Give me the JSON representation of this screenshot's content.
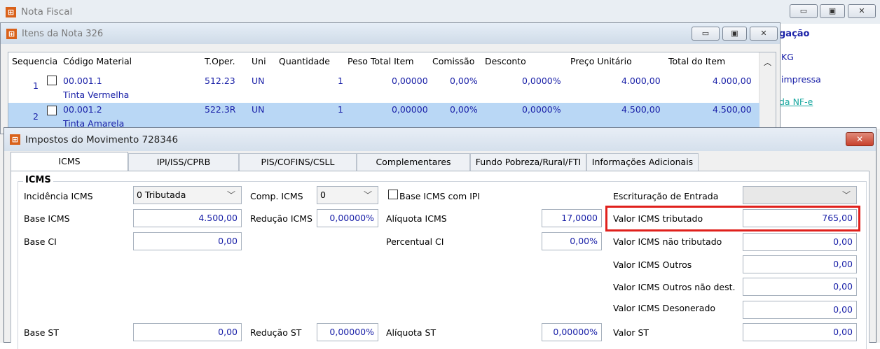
{
  "nota_window": {
    "title": "Nota Fiscal",
    "right_links": [
      "gação",
      "KG",
      "impressa",
      "da NF-e"
    ]
  },
  "itens_window": {
    "title": "Itens da Nota 326",
    "columns": [
      "Sequencia",
      "Código Material",
      "T.Oper.",
      "Uni",
      "Quantidade",
      "Peso Total Item",
      "Comissão",
      "Desconto",
      "Preço Unitário",
      "Total do Item"
    ],
    "rows": [
      {
        "seq": "1",
        "code": "00.001.1",
        "desc": "Tinta Vermelha",
        "toper": "512.23",
        "uni": "UN",
        "qtd": "1",
        "peso": "0,00000",
        "comissao": "0,00%",
        "desconto": "0,0000%",
        "preco": "4.000,00",
        "total": "4.000,00"
      },
      {
        "seq": "2",
        "code": "00.001.2",
        "desc": "Tinta Amarela",
        "toper": "522.3R",
        "uni": "UN",
        "qtd": "1",
        "peso": "0,00000",
        "comissao": "0,00%",
        "desconto": "0,0000%",
        "preco": "4.500,00",
        "total": "4.500,00"
      }
    ]
  },
  "impostos_window": {
    "title": "Impostos do Movimento 728346",
    "close_label": "✕",
    "tabs": [
      "ICMS",
      "IPI/ISS/CPRB",
      "PIS/COFINS/CSLL",
      "Complementares",
      "Fundo Pobreza/Rural/FTI",
      "Informações Adicionais"
    ],
    "active_tab": "ICMS",
    "group_title": "ICMS",
    "incidencia_label": "Incidência ICMS",
    "incidencia_value": "0 Tributada",
    "comp_label": "Comp. ICMS",
    "comp_value": "0",
    "base_ipi_label": "Base ICMS com IPI",
    "escrituracao_label": "Escrituração de Entrada",
    "escrituracao_value": "",
    "base_icms_label": "Base ICMS",
    "base_icms_value": "4.500,00",
    "reducao_icms_label": "Redução ICMS",
    "reducao_icms_value": "0,00000%",
    "aliquota_icms_label": "Alíquota ICMS",
    "aliquota_icms_value": "17,0000",
    "valor_tributado_label": "Valor ICMS tributado",
    "valor_tributado_value": "765,00",
    "base_ci_label": "Base CI",
    "base_ci_value": "0,00",
    "percentual_ci_label": "Percentual CI",
    "percentual_ci_value": "0,00%",
    "nao_tributado_label": "Valor ICMS não tributado",
    "nao_tributado_value": "0,00",
    "outros_label": "Valor ICMS Outros",
    "outros_value": "0,00",
    "outros_nao_dest_label": "Valor ICMS Outros não dest.",
    "outros_nao_dest_value": "0,00",
    "desonerado_label": "Valor ICMS Desonerado",
    "desonerado_value": "0,00",
    "base_st_label": "Base ST",
    "base_st_value": "0,00",
    "reducao_st_label": "Redução ST",
    "reducao_st_value": "0,00000%",
    "aliquota_st_label": "Alíquota ST",
    "aliquota_st_value": "0,00000%",
    "valor_st_label": "Valor ST",
    "valor_st_value": "0,00"
  },
  "colors": {
    "highlight_border": "#e0201c",
    "selected_row": "#b9d7f5",
    "value_text": "#1a21a8"
  },
  "icons": {
    "app": "app-logo-icon",
    "minimize": "minimize-icon",
    "restore": "restore-icon",
    "close": "close-icon",
    "dropdown": "chevron-down-icon",
    "scroll_up": "scroll-up-icon"
  }
}
